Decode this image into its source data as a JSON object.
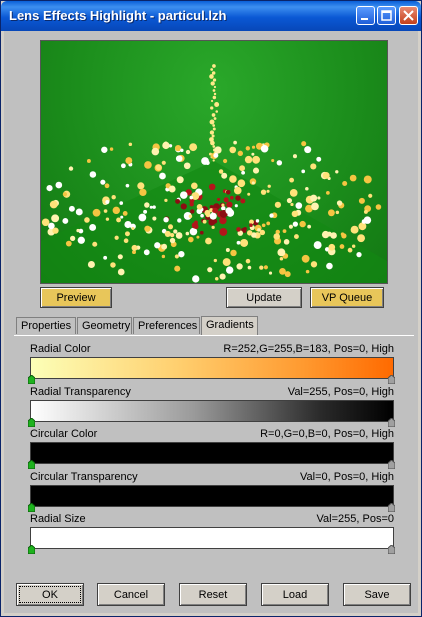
{
  "window": {
    "title": "Lens Effects Highlight - particul.lzh"
  },
  "buttons": {
    "preview": "Preview",
    "update": "Update",
    "vp_queue": "VP Queue"
  },
  "tabs": [
    "Properties",
    "Geometry",
    "Preferences",
    "Gradients"
  ],
  "gradients": [
    {
      "label": "Radial Color",
      "info": "R=252,G=255,B=183, Pos=0, High"
    },
    {
      "label": "Radial Transparency",
      "info": "Val=255, Pos=0, High"
    },
    {
      "label": "Circular Color",
      "info": "R=0,G=0,B=0, Pos=0, High"
    },
    {
      "label": "Circular Transparency",
      "info": "Val=0, Pos=0, High"
    },
    {
      "label": "Radial Size",
      "info": "Val=255, Pos=0"
    }
  ],
  "footer": {
    "ok": "OK",
    "cancel": "Cancel",
    "reset": "Reset",
    "load": "Load",
    "save": "Save"
  },
  "colors": {
    "left_marker": "#1db21d",
    "right_marker": "#a0a0a0",
    "radial_color_start": "#fcffb7",
    "radial_color_end": "#ff6a00"
  }
}
